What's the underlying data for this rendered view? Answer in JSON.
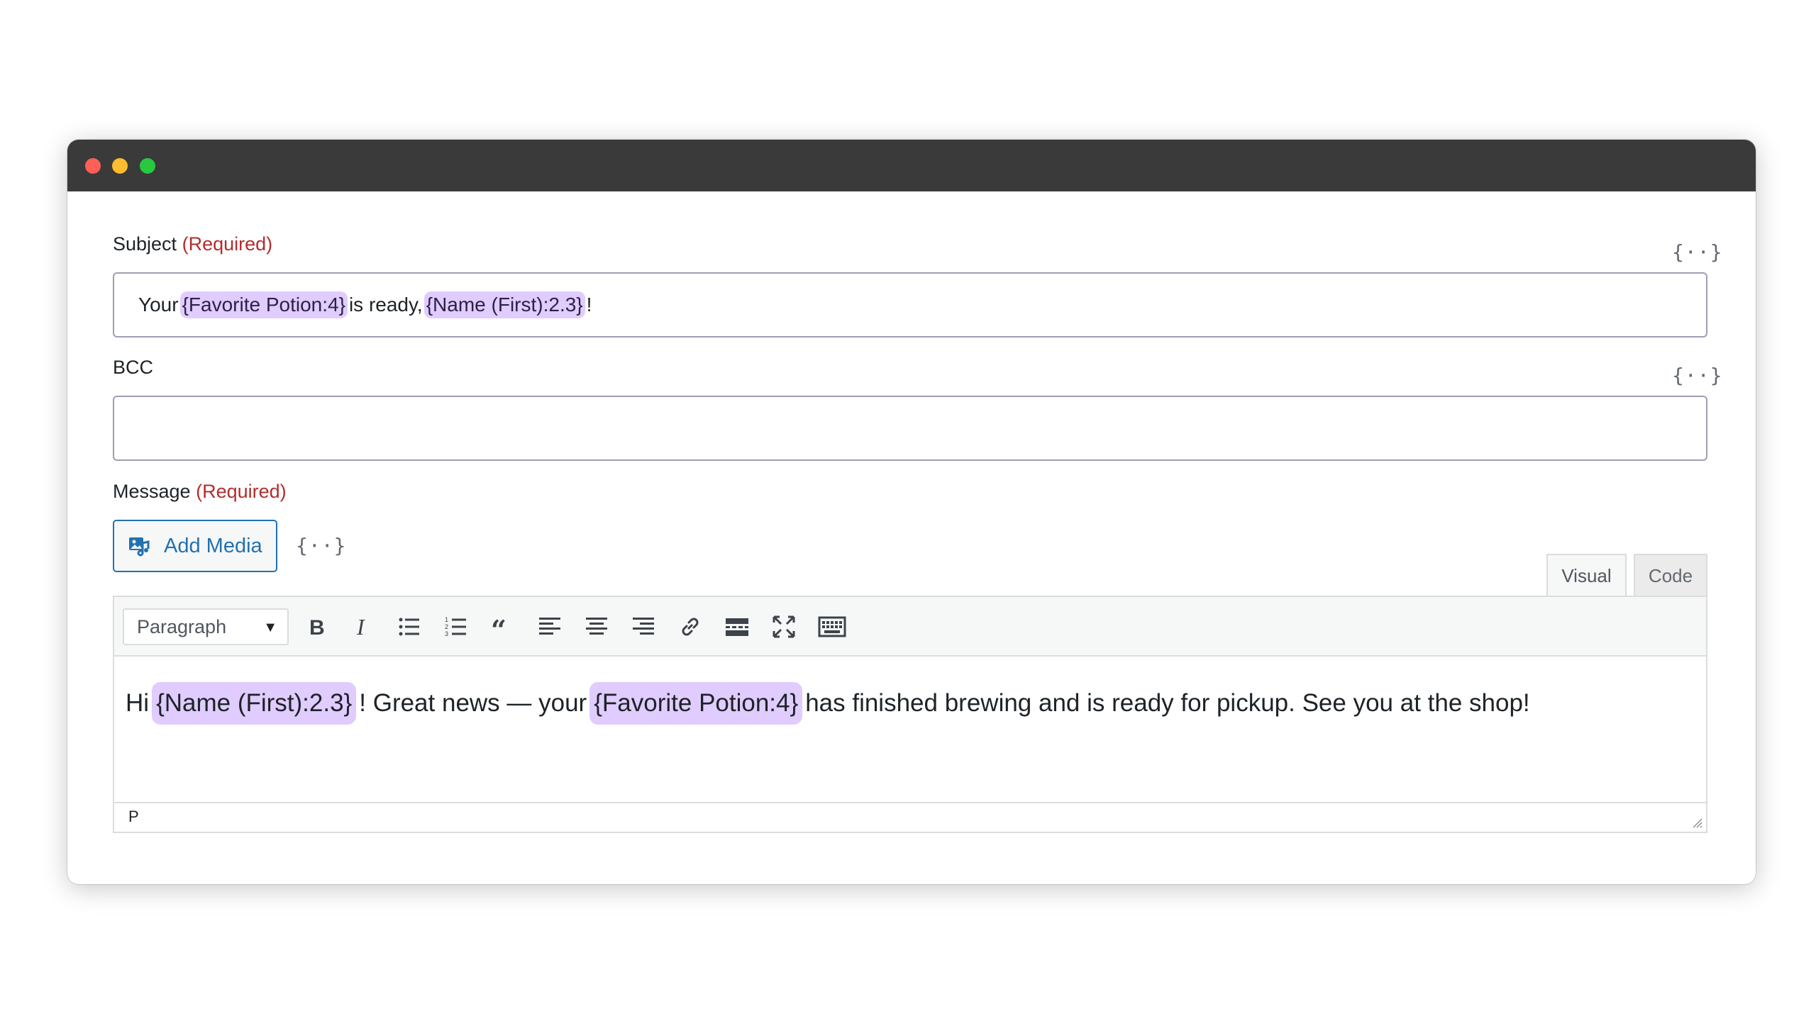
{
  "subject": {
    "label": "Subject",
    "required": "(Required)",
    "merge_icon": "{··}",
    "value_parts": [
      "Your ",
      "{Favorite Potion:4}",
      " is ready, ",
      "{Name (First):2.3}",
      "!"
    ]
  },
  "bcc": {
    "label": "BCC",
    "merge_icon": "{··}",
    "value": ""
  },
  "message": {
    "label": "Message",
    "required": "(Required)",
    "add_media_label": "Add Media",
    "merge_icon": "{··}",
    "tabs": [
      "Visual",
      "Code"
    ],
    "format_select": "Paragraph",
    "toolbar_icons": [
      "bold-icon",
      "italic-icon",
      "bullet-list-icon",
      "numbered-list-icon",
      "blockquote-icon",
      "align-left-icon",
      "align-center-icon",
      "align-right-icon",
      "link-icon",
      "read-more-icon",
      "fullscreen-icon",
      "toolbar-toggle-icon"
    ],
    "content_parts": [
      "Hi ",
      "{Name (First):2.3}",
      "! Great news — your ",
      "{Favorite Potion:4}",
      " has finished brewing and is ready for pickup. See you at the shop!"
    ],
    "status_path": "P"
  },
  "colors": {
    "chip": "#e0ccff",
    "required": "#b32d2e",
    "accent": "#2271b1",
    "titlebar": "#3a3a3a"
  }
}
